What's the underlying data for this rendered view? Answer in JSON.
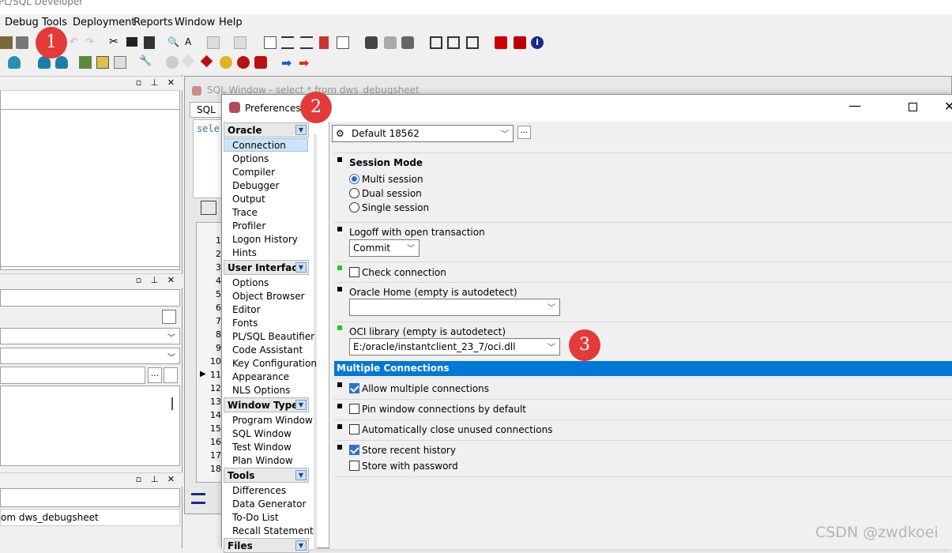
{
  "app": {
    "title": "PL/SQL Developer"
  },
  "menu": [
    "Debug",
    "Tools",
    "Deployment",
    "Reports",
    "Window",
    "Help"
  ],
  "left_panel": {
    "bottom_text": "om dws_debugsheet",
    "browse_button": "..."
  },
  "sql_window": {
    "title": "SQL Window - select * from dws_debugsheet",
    "tab": "SQL",
    "code_fragment": "sele",
    "row_numbers": [
      "1",
      "2",
      "3",
      "4",
      "5",
      "6",
      "7",
      "8",
      "9",
      "10",
      "11",
      "12",
      "13",
      "14",
      "15",
      "16",
      "17",
      "18"
    ]
  },
  "dialog": {
    "title": "Preferences",
    "profile": "Default 18562",
    "profile_button": "...",
    "nav": [
      {
        "category": "Oracle",
        "items": [
          "Connection",
          "Options",
          "Compiler",
          "Debugger",
          "Output",
          "Trace",
          "Profiler",
          "Logon History",
          "Hints"
        ]
      },
      {
        "category": "User Interface",
        "items": [
          "Options",
          "Object Browser",
          "Editor",
          "Fonts",
          "PL/SQL Beautifier",
          "Code Assistant",
          "Key Configuration",
          "Appearance",
          "NLS Options"
        ]
      },
      {
        "category": "Window Types",
        "items": [
          "Program Window",
          "SQL Window",
          "Test Window",
          "Plan Window"
        ]
      },
      {
        "category": "Tools",
        "items": [
          "Differences",
          "Data Generator",
          "To-Do List",
          "Recall Statement"
        ]
      },
      {
        "category": "Files",
        "items": []
      }
    ],
    "selected_nav": "Connection",
    "session_mode": {
      "label": "Session Mode",
      "options": [
        "Multi session",
        "Dual session",
        "Single session"
      ],
      "selected": "Multi session"
    },
    "logoff": {
      "label": "Logoff with open transaction",
      "value": "Commit"
    },
    "check_connection": {
      "label": "Check connection",
      "checked": false
    },
    "oracle_home": {
      "label": "Oracle Home (empty is autodetect)",
      "value": ""
    },
    "oci_library": {
      "label": "OCI library (empty is autodetect)",
      "value": "E:/oracle/instantclient_23_7/oci.dll"
    },
    "multiple_connections": {
      "header": "Multiple Connections",
      "allow": {
        "label": "Allow multiple connections",
        "checked": true
      },
      "pin": {
        "label": "Pin window connections by default",
        "checked": false
      },
      "auto_close": {
        "label": "Automatically close unused connections",
        "checked": false
      },
      "store_history": {
        "label": "Store recent history",
        "checked": true
      },
      "store_password": {
        "label": "Store with password",
        "checked": false
      }
    }
  },
  "annotations": [
    "1",
    "2",
    "3"
  ],
  "watermark": "CSDN @zwdkoei",
  "colors": {
    "accent": "#0078d7",
    "badge": "#e33a3a",
    "modified_marker": "#22c922"
  }
}
